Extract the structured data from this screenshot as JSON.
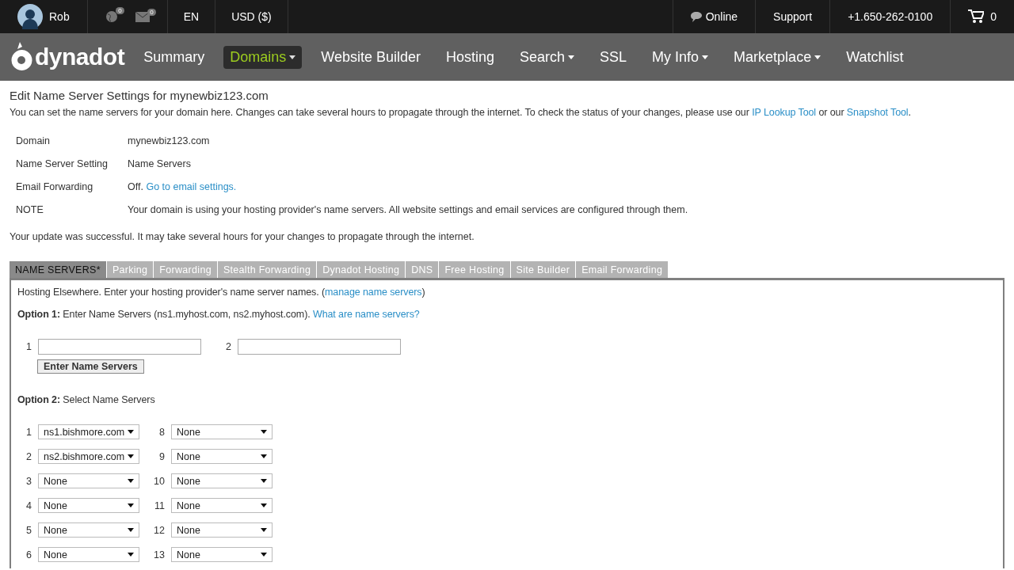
{
  "top_bar": {
    "user": "Rob",
    "globe_count": "0",
    "mail_count": "0",
    "language": "EN",
    "currency": "USD ($)",
    "chat": "Online",
    "support": "Support",
    "phone": "+1.650-262-0100",
    "cart_count": "0"
  },
  "nav": {
    "logo": "dynadot",
    "items": [
      {
        "label": "Summary",
        "selected": false,
        "dropdown": false
      },
      {
        "label": "Domains",
        "selected": true,
        "dropdown": true
      },
      {
        "label": "Website Builder",
        "selected": false,
        "dropdown": false
      },
      {
        "label": "Hosting",
        "selected": false,
        "dropdown": false
      },
      {
        "label": "Search",
        "selected": false,
        "dropdown": true
      },
      {
        "label": "SSL",
        "selected": false,
        "dropdown": false
      },
      {
        "label": "My Info",
        "selected": false,
        "dropdown": true
      },
      {
        "label": "Marketplace",
        "selected": false,
        "dropdown": true
      },
      {
        "label": "Watchlist",
        "selected": false,
        "dropdown": false
      }
    ]
  },
  "page_title": "Edit Name Server Settings for mynewbiz123.com",
  "intro": {
    "text": "You can set the name servers for your domain here. Changes can take several hours to propagate through the internet. To check the status of your changes, please use our",
    "link1": "IP Lookup Tool",
    "middle": "or our",
    "link2": "Snapshot Tool",
    "end": "."
  },
  "details": [
    {
      "label": "Domain",
      "value": "mynewbiz123.com"
    },
    {
      "label": "Name Server Setting",
      "value": "Name Servers"
    },
    {
      "label": "Email Forwarding",
      "value": "Off.",
      "link": "Go to email settings."
    },
    {
      "label": "NOTE",
      "value": "Your domain is using your hosting provider's name servers. All website settings and email services are configured through them."
    }
  ],
  "success_message": "Your update was successful. It may take several hours for your changes to propagate through the internet.",
  "tabs": [
    {
      "label": "NAME SERVERS*",
      "selected": true
    },
    {
      "label": "Parking",
      "selected": false
    },
    {
      "label": "Forwarding",
      "selected": false
    },
    {
      "label": "Stealth Forwarding",
      "selected": false
    },
    {
      "label": "Dynadot Hosting",
      "selected": false
    },
    {
      "label": "DNS",
      "selected": false
    },
    {
      "label": "Free Hosting",
      "selected": false
    },
    {
      "label": "Site Builder",
      "selected": false
    },
    {
      "label": "Email Forwarding",
      "selected": false
    }
  ],
  "panel": {
    "hosting_text": "Hosting Elsewhere. Enter your hosting provider's name server names. (",
    "hosting_link": "manage name servers",
    "hosting_end": ")",
    "option1": {
      "label": "Option 1:",
      "text": "Enter Name Servers (ns1.myhost.com, ns2.myhost.com).",
      "link": "What are name servers?"
    },
    "fields": [
      {
        "number": "1"
      },
      {
        "number": "2"
      }
    ],
    "enter_button": "Enter Name Servers",
    "option2": {
      "label": "Option 2:",
      "text": "Select Name Servers"
    },
    "selects": [
      [
        {
          "number": "1",
          "value": "ns1.bishmore.com"
        },
        {
          "number": "8",
          "value": "None"
        }
      ],
      [
        {
          "number": "2",
          "value": "ns2.bishmore.com"
        },
        {
          "number": "9",
          "value": "None"
        }
      ],
      [
        {
          "number": "3",
          "value": "None"
        },
        {
          "number": "10",
          "value": "None"
        }
      ],
      [
        {
          "number": "4",
          "value": "None"
        },
        {
          "number": "11",
          "value": "None"
        }
      ],
      [
        {
          "number": "5",
          "value": "None"
        },
        {
          "number": "12",
          "value": "None"
        }
      ],
      [
        {
          "number": "6",
          "value": "None"
        },
        {
          "number": "13",
          "value": "None"
        }
      ]
    ]
  }
}
